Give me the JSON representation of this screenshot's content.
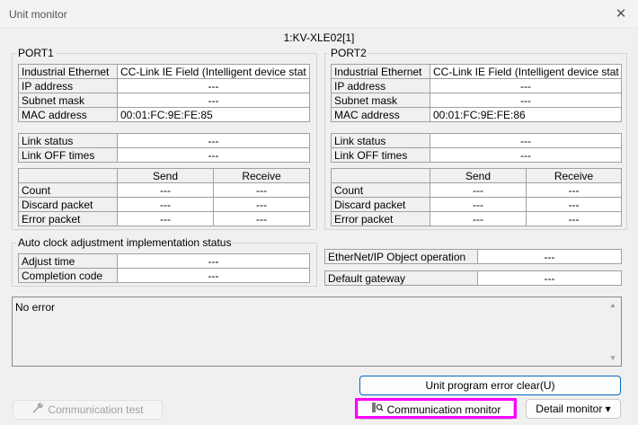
{
  "window": {
    "title": "Unit monitor",
    "close_glyph": "✕"
  },
  "unit_name": "1:KV-XLE02[1]",
  "port1": {
    "title": "PORT1",
    "info": [
      {
        "label": "Industrial Ethernet",
        "value": "CC-Link IE Field (Intelligent device stat"
      },
      {
        "label": "IP address",
        "value": "---"
      },
      {
        "label": "Subnet mask",
        "value": "---"
      },
      {
        "label": "MAC address",
        "value": "00:01:FC:9E:FE:85"
      }
    ],
    "link": [
      {
        "label": "Link status",
        "value": "---"
      },
      {
        "label": "Link OFF times",
        "value": "---"
      }
    ],
    "packets": {
      "headers": [
        "Send",
        "Receive"
      ],
      "rows": [
        {
          "label": "Count",
          "send": "---",
          "receive": "---"
        },
        {
          "label": "Discard packet",
          "send": "---",
          "receive": "---"
        },
        {
          "label": "Error packet",
          "send": "---",
          "receive": "---"
        }
      ]
    }
  },
  "port2": {
    "title": "PORT2",
    "info": [
      {
        "label": "Industrial Ethernet",
        "value": "CC-Link IE Field (Intelligent device stat"
      },
      {
        "label": "IP address",
        "value": "---"
      },
      {
        "label": "Subnet mask",
        "value": "---"
      },
      {
        "label": "MAC address",
        "value": "00:01:FC:9E:FE:86"
      }
    ],
    "link": [
      {
        "label": "Link status",
        "value": "---"
      },
      {
        "label": "Link OFF times",
        "value": "---"
      }
    ],
    "packets": {
      "headers": [
        "Send",
        "Receive"
      ],
      "rows": [
        {
          "label": "Count",
          "send": "---",
          "receive": "---"
        },
        {
          "label": "Discard packet",
          "send": "---",
          "receive": "---"
        },
        {
          "label": "Error packet",
          "send": "---",
          "receive": "---"
        }
      ]
    }
  },
  "auto_clock": {
    "title": "Auto clock adjustment implementation status",
    "rows": [
      {
        "label": "Adjust time",
        "value": "---"
      },
      {
        "label": "Completion code",
        "value": "---"
      }
    ]
  },
  "ethernet_ip": {
    "label": "EtherNet/IP Object operation",
    "value": "---"
  },
  "default_gateway": {
    "label": "Default gateway",
    "value": "---"
  },
  "message": {
    "text": "No error",
    "scroll_up": "▲",
    "scroll_down": "▼"
  },
  "buttons": {
    "unit_program_error_clear": "Unit program error clear(U)",
    "communication_test": "Communication test",
    "communication_monitor": "Communication monitor",
    "detail_monitor": "Detail monitor",
    "detail_arrow": "▾"
  },
  "colors": {
    "highlight": "#ff00ff",
    "accent": "#0067c0"
  }
}
